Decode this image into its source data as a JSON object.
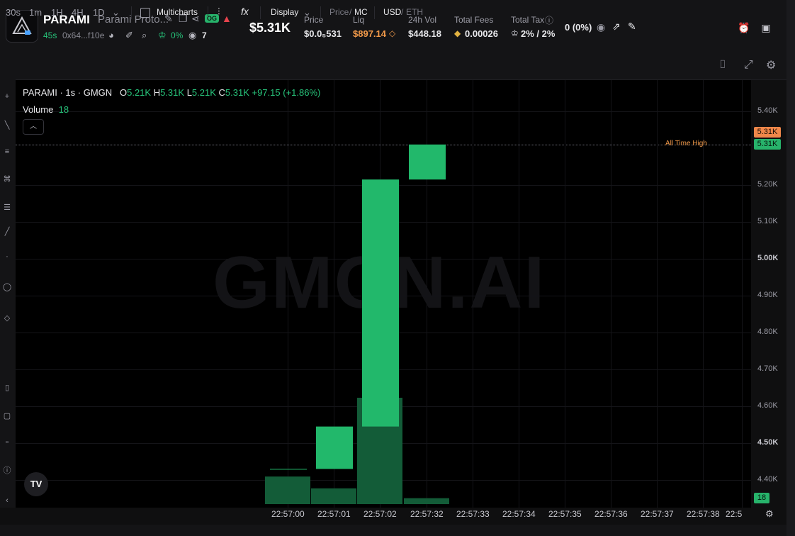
{
  "header": {
    "symbol": "PARAMI",
    "token_name": "Parami Proto...",
    "og_badge": "OG",
    "age": "45s",
    "address": "0x64...f10e",
    "holder_pct": "0%",
    "watchers": "7",
    "market_cap": "$5.31K",
    "stats": [
      {
        "label": "Price",
        "value": "$0.0₅531"
      },
      {
        "label": "Liq",
        "value": "$897.14",
        "color": "#f29a4a"
      },
      {
        "label": "24h Vol",
        "value": "$448.18"
      },
      {
        "label": "Total Fees",
        "value": "0.00026"
      },
      {
        "label": "Total Tax",
        "value": "2% / 2%"
      }
    ],
    "pnl": "0 (0%)",
    "icons": [
      "edit-icon",
      "copy-icon",
      "share-icon",
      "warning-icon",
      "chart-icon",
      "edit-note-icon",
      "search-icon",
      "chef-hat-icon",
      "eye-icon",
      "external-link-icon",
      "pin-icon",
      "alarm-icon",
      "panel-icon"
    ]
  },
  "toolbar": {
    "timeframes": [
      "30s",
      "1m",
      "1H",
      "4H",
      "1D"
    ],
    "multicharts": "Multicharts",
    "display": "Display",
    "price_label": "Price",
    "mc_label": "MC",
    "usd_label": "USD",
    "eth_label": "ETH"
  },
  "chart_data": {
    "type": "candlestick",
    "title": "PARAMI · 1s · GMGN",
    "ohlc": {
      "o": "5.21K",
      "h": "5.31K",
      "l": "5.21K",
      "c": "5.31K",
      "change": "+97.15 (+1.86%)"
    },
    "volume_label": "Volume",
    "volume_value": "18",
    "watermark": "GMGN.AI",
    "x_ticks": [
      "22:57:00",
      "22:57:01",
      "22:57:02",
      "22:57:32",
      "22:57:33",
      "22:57:34",
      "22:57:35",
      "22:57:36",
      "22:57:37",
      "22:57:38",
      "22:5"
    ],
    "y_ticks": [
      "5.40K",
      "5.31K",
      "5.20K",
      "5.10K",
      "5.00K",
      "4.90K",
      "4.80K",
      "4.70K",
      "4.60K",
      "4.50K",
      "4.40K"
    ],
    "y_bold_ticks": [
      "5.00K",
      "4.50K"
    ],
    "ylim": [
      4.35,
      5.45
    ],
    "candles": [
      {
        "x": "22:57:00",
        "open": 4.43,
        "close": 4.43,
        "high": 4.43,
        "low": 4.43
      },
      {
        "x": "22:57:01",
        "open": 4.43,
        "close": 4.545,
        "high": 4.545,
        "low": 4.43
      },
      {
        "x": "22:57:02",
        "open": 4.545,
        "close": 5.215,
        "high": 5.215,
        "low": 4.545
      },
      {
        "x": "22:57:32",
        "open": 5.215,
        "close": 5.31,
        "high": 5.31,
        "low": 5.215
      }
    ],
    "volume": [
      {
        "x": "22:57:00",
        "value": 7
      },
      {
        "x": "22:57:01",
        "value": 4
      },
      {
        "x": "22:57:02",
        "value": 27
      },
      {
        "x": "22:57:32",
        "value": 1.5
      }
    ],
    "ath_label": "All Time High",
    "ath_value": 5.31,
    "price_tags": [
      {
        "label": "5.31K",
        "color": "#f0874a"
      },
      {
        "label": "5.31K",
        "color": "#27b36b"
      },
      {
        "label": "18",
        "color": "#27b36b"
      }
    ],
    "up_color": "#22b86b",
    "vol_color": "#135c38"
  }
}
